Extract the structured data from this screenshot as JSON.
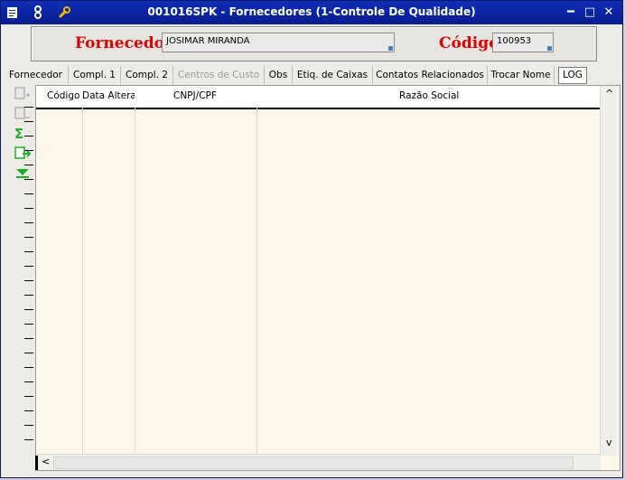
{
  "window": {
    "title": "001016SPK - Fornecedores (1-Controle De Qualidade)",
    "minimize_label": "━",
    "restore_label": "□",
    "close_label": "✕"
  },
  "header": {
    "fornecedor_label": "Fornecedor",
    "fornecedor_value": "JOSIMAR MIRANDA",
    "codigo_label": "Código",
    "codigo_value": "100953"
  },
  "tabs": [
    {
      "label": "Fornecedor",
      "state": "normal"
    },
    {
      "label": "Compl. 1",
      "state": "normal"
    },
    {
      "label": "Compl. 2",
      "state": "normal"
    },
    {
      "label": "Centros de Custo",
      "state": "disabled"
    },
    {
      "label": "Obs",
      "state": "normal"
    },
    {
      "label": "Etiq. de Caixas",
      "state": "normal"
    },
    {
      "label": "Contatos Relacionados",
      "state": "normal"
    },
    {
      "label": "Trocar Nome",
      "state": "normal"
    },
    {
      "label": "LOG",
      "state": "active"
    }
  ],
  "grid": {
    "columns": [
      "Código",
      "Data Alteraç",
      "CNPJ/CPF",
      "Razão Social"
    ],
    "rows": []
  },
  "sidebar_icons": [
    "add-record-icon",
    "remove-record-icon",
    "sum-icon",
    "export-icon",
    "jump-bottom-icon"
  ],
  "scroll": {
    "up": "^",
    "down": "v",
    "left": "<"
  },
  "colors": {
    "title_bar": "#0a24a4",
    "label_red": "#e00000",
    "grid_bg": "#fdf7e8",
    "icon_green": "#1fae2a"
  }
}
